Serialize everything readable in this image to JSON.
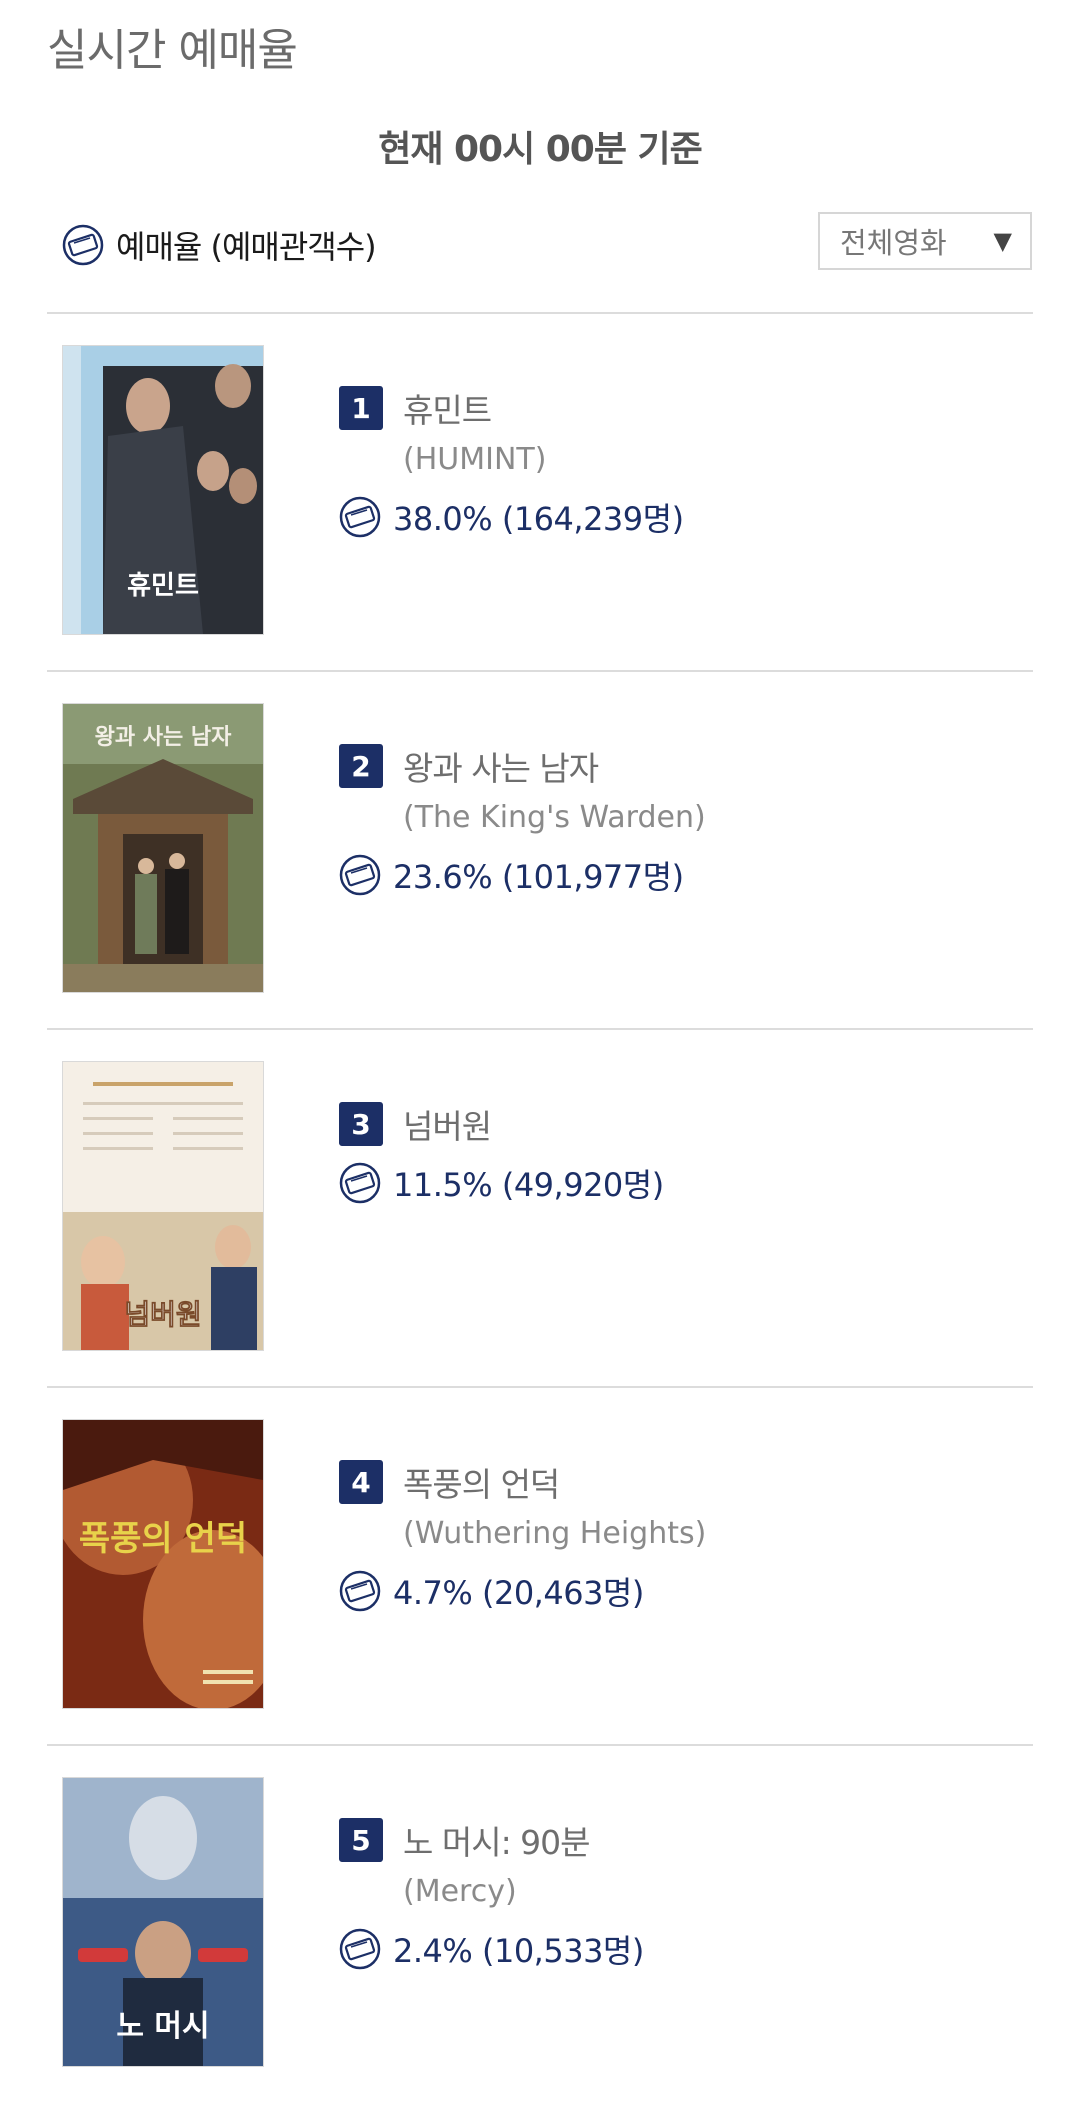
{
  "header": {
    "title": "실시간 예매율",
    "timestamp": "현재  00시 00분   기준"
  },
  "legend": {
    "icon": "ticket-icon",
    "label": "예매율 (예매관객수)"
  },
  "filter": {
    "selected": "전체영화",
    "caret": "▼"
  },
  "colors": {
    "accent": "#1c2f66",
    "title_gray": "#6e6e6e",
    "divider": "#dcdcdc"
  },
  "movies": [
    {
      "rank": "1",
      "title": "휴민트",
      "subtitle": "(HUMINT)",
      "rate": "38.0% (164,239명)",
      "poster_text": "휴민트"
    },
    {
      "rank": "2",
      "title": "왕과 사는 남자",
      "subtitle": "(The King's Warden)",
      "rate": "23.6% (101,977명)",
      "poster_text": "왕과 사는 남자"
    },
    {
      "rank": "3",
      "title": "넘버원",
      "subtitle": "",
      "rate": "11.5% (49,920명)",
      "poster_text": "넘버원"
    },
    {
      "rank": "4",
      "title": "폭풍의 언덕",
      "subtitle": "(Wuthering Heights)",
      "rate": "4.7% (20,463명)",
      "poster_text": "폭풍의 언덕"
    },
    {
      "rank": "5",
      "title": "노 머시: 90분",
      "subtitle": "(Mercy)",
      "rate": "2.4% (10,533명)",
      "poster_text": "노 머시"
    }
  ]
}
